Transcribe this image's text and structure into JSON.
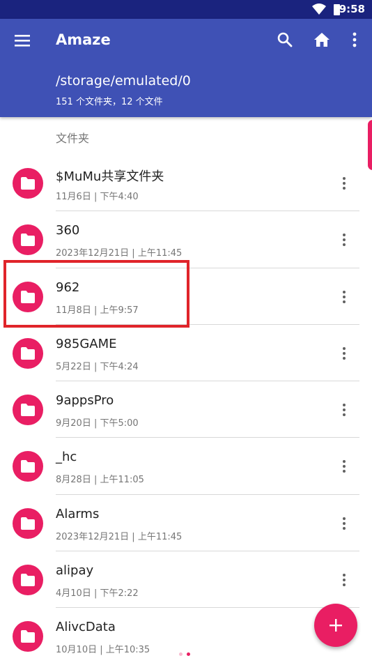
{
  "status_bar": {
    "time": "9:58"
  },
  "app_bar": {
    "title": "Amaze",
    "path": "/storage/emulated/0",
    "summary": "151 个文件夹，12 个文件"
  },
  "section": {
    "header": "文件夹"
  },
  "folders": [
    {
      "name": "$MuMu共享文件夹",
      "date": "11月6日 | 下午4:40"
    },
    {
      "name": "360",
      "date": "2023年12月21日 | 上午11:45"
    },
    {
      "name": "962",
      "date": "11月8日 | 上午9:57"
    },
    {
      "name": "985GAME",
      "date": "5月22日 | 下午4:24"
    },
    {
      "name": "9appsPro",
      "date": "9月20日 | 下午5:00"
    },
    {
      "name": "_hc",
      "date": "8月28日 | 上午11:05"
    },
    {
      "name": "Alarms",
      "date": "2023年12月21日 | 上午11:45"
    },
    {
      "name": "alipay",
      "date": "4月10日 | 下午2:22"
    },
    {
      "name": "AlivcData",
      "date": "10月10日 | 上午10:35"
    }
  ],
  "colors": {
    "status_bar": "#1a237e",
    "app_bar": "#3f51b5",
    "accent": "#e91e63",
    "highlight_box": "#e0242a"
  },
  "icons": {
    "menu": "menu-icon",
    "search": "search-icon",
    "home": "home-icon",
    "overflow": "more-vert-icon",
    "folder": "folder-icon",
    "fab": "plus-icon"
  }
}
